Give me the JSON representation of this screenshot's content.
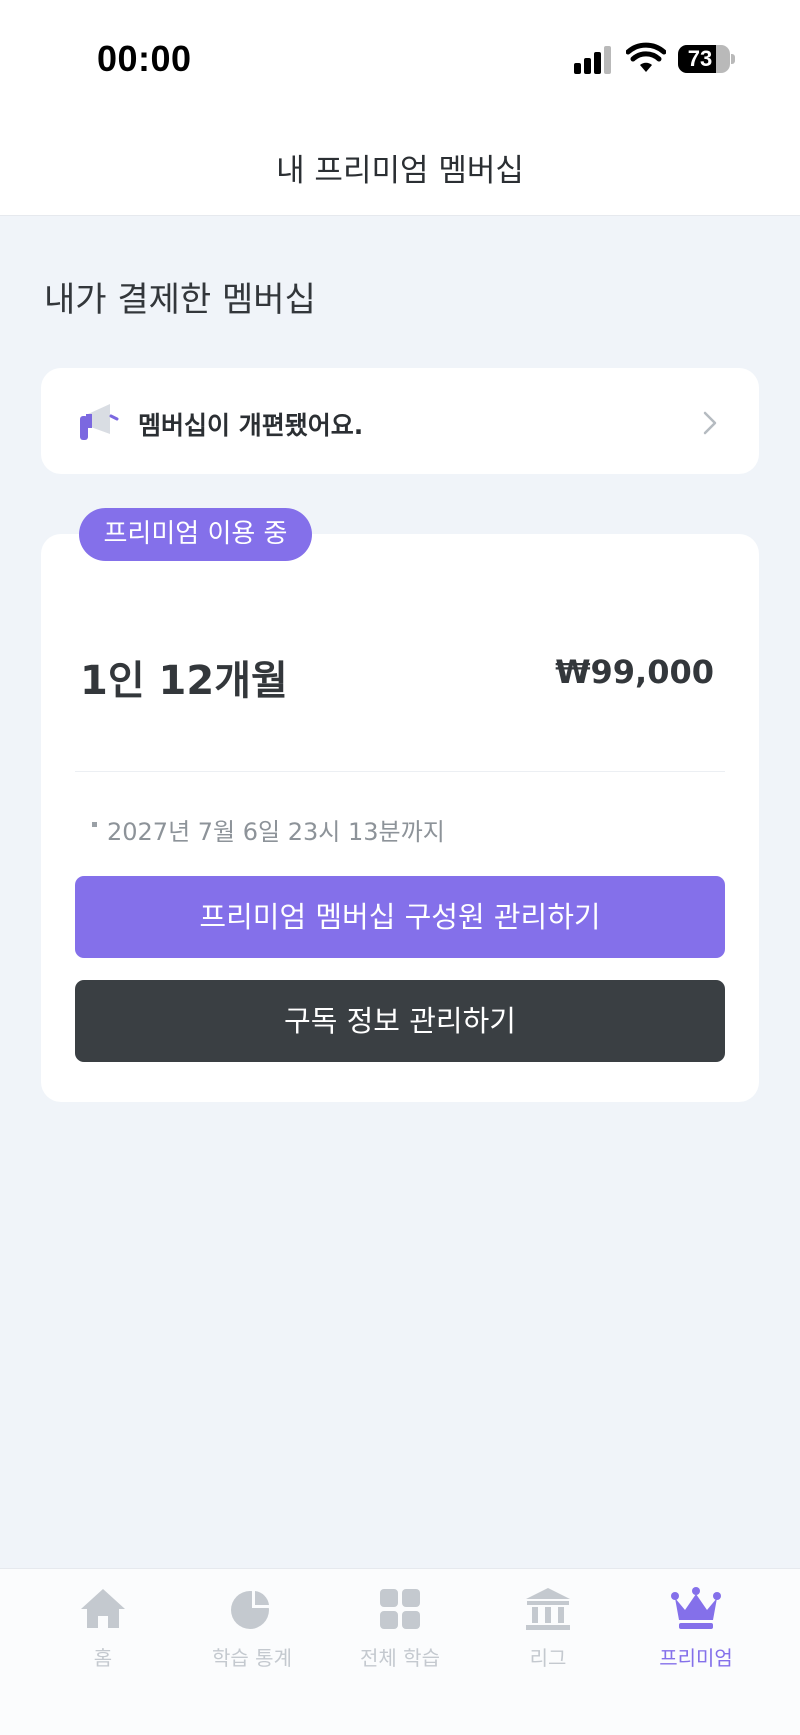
{
  "status_bar": {
    "time": "00:00",
    "battery_percent": "73",
    "battery_level": 0.73,
    "icons": [
      "cellular-signal-icon",
      "wifi-icon",
      "battery-icon"
    ]
  },
  "header": {
    "title": "내 프리미엄 멤버십"
  },
  "section": {
    "title": "내가 결제한 멤버십"
  },
  "notice": {
    "icon": "megaphone-icon",
    "text": "멤버십이 개편됐어요.",
    "chevron": "chevron-right-icon"
  },
  "membership": {
    "status_badge": "프리미엄 이용 중",
    "plan_name": "1인 12개월",
    "price": "₩99,000",
    "expiry": "2027년 7월 6일 23시 13분까지",
    "manage_members_label": "프리미엄 멤버십 구성원 관리하기",
    "manage_subscription_label": "구독 정보 관리하기"
  },
  "tab_bar": {
    "items": [
      {
        "label": "홈",
        "icon": "home-icon",
        "active": false
      },
      {
        "label": "학습 통계",
        "icon": "pie-chart-icon",
        "active": false
      },
      {
        "label": "전체 학습",
        "icon": "grid-icon",
        "active": false
      },
      {
        "label": "리그",
        "icon": "bank-building-icon",
        "active": false
      },
      {
        "label": "프리미엄",
        "icon": "crown-icon",
        "active": true
      }
    ]
  },
  "colors": {
    "accent": "#8470ea",
    "dark_button": "#3a3f43",
    "background": "#f0f4f9",
    "tab_inactive": "#c4c9cf"
  }
}
